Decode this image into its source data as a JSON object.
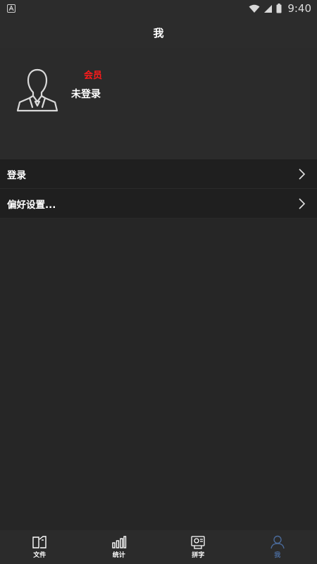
{
  "status_bar": {
    "time": "9:40",
    "notification_icon": "a-badge-icon",
    "icons": [
      "wifi-icon",
      "signal-icon",
      "battery-icon"
    ]
  },
  "header": {
    "title": "我"
  },
  "profile": {
    "member_badge": "会员",
    "login_status": "未登录",
    "avatar_icon": "user-avatar-icon"
  },
  "menu": {
    "items": [
      {
        "label": "登录"
      },
      {
        "label": "偏好设置..."
      }
    ]
  },
  "bottom_nav": {
    "items": [
      {
        "label": "文件",
        "icon": "file-icon"
      },
      {
        "label": "统计",
        "icon": "bar-chart-icon"
      },
      {
        "label": "拼字",
        "icon": "puzzle-icon"
      },
      {
        "label": "我",
        "icon": "person-icon",
        "active": true
      }
    ]
  },
  "colors": {
    "background": "#262626",
    "header": "#2c2c2c",
    "member_badge": "#ff1a1a",
    "active_tab": "#4a6a9a"
  }
}
